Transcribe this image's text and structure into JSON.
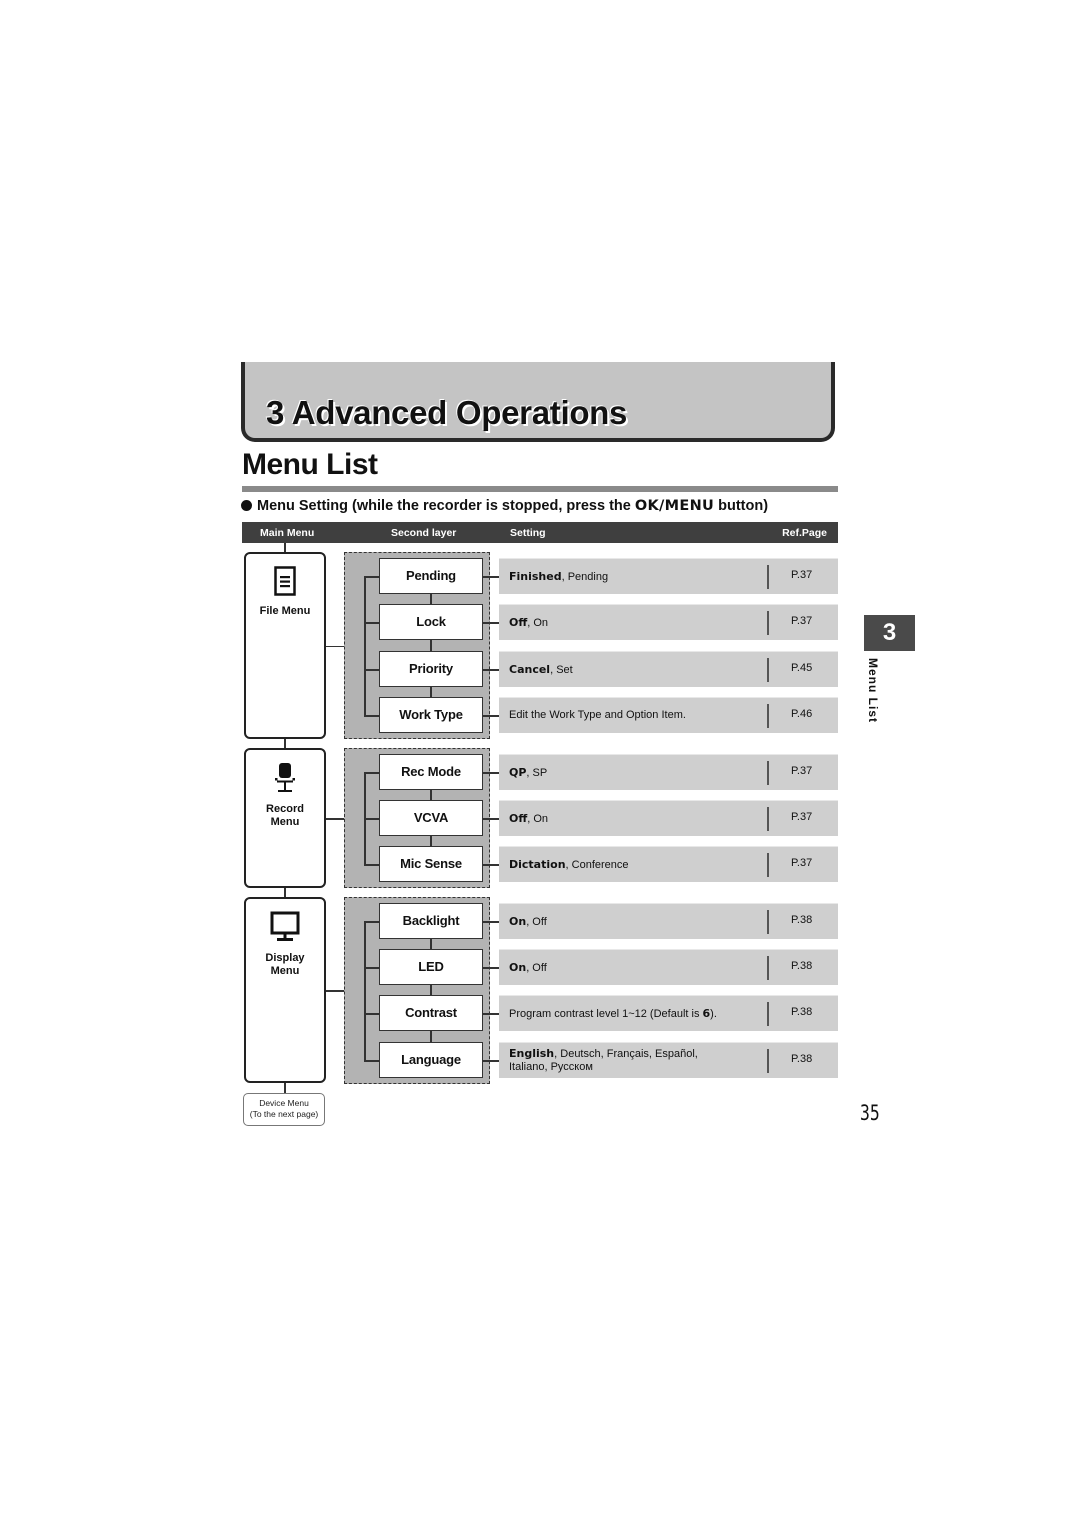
{
  "chapter": {
    "number": "3",
    "title": "3  Advanced Operations"
  },
  "page_title": "Menu List",
  "subheading": {
    "prefix": "Menu Setting (while the recorder is stopped, press the ",
    "button_name": "OK/MENU",
    "suffix": " button)"
  },
  "table_header": {
    "main_menu": "Main Menu",
    "second_layer": "Second layer",
    "setting": "Setting",
    "ref_page": "Ref.Page"
  },
  "menus": [
    {
      "icon": "file-document-icon",
      "label_lines": [
        "File Menu"
      ],
      "items": [
        {
          "name": "Pending",
          "setting_bold": "Finished",
          "setting_rest": ", Pending",
          "setting_line2": "",
          "ref": "P.37"
        },
        {
          "name": "Lock",
          "setting_bold": "Off",
          "setting_rest": ", On",
          "setting_line2": "",
          "ref": "P.37"
        },
        {
          "name": "Priority",
          "setting_bold": "Cancel",
          "setting_rest": ", Set",
          "setting_line2": "",
          "ref": "P.45"
        },
        {
          "name": "Work Type",
          "setting_bold": "",
          "setting_rest": "Edit the Work Type and Option Item.",
          "setting_line2": "",
          "ref": "P.46"
        }
      ]
    },
    {
      "icon": "microphone-stand-icon",
      "label_lines": [
        "Record",
        "Menu"
      ],
      "items": [
        {
          "name": "Rec Mode",
          "setting_bold": "QP",
          "setting_rest": ", SP",
          "setting_line2": "",
          "ref": "P.37"
        },
        {
          "name": "VCVA",
          "setting_bold": "Off",
          "setting_rest": ", On",
          "setting_line2": "",
          "ref": "P.37"
        },
        {
          "name": "Mic Sense",
          "setting_bold": "Dictation",
          "setting_rest": ", Conference",
          "setting_line2": "",
          "ref": "P.37"
        }
      ]
    },
    {
      "icon": "monitor-display-icon",
      "label_lines": [
        "Display",
        "Menu"
      ],
      "items": [
        {
          "name": "Backlight",
          "setting_bold": "On",
          "setting_rest": ", Off",
          "setting_line2": "",
          "ref": "P.38"
        },
        {
          "name": "LED",
          "setting_bold": "On",
          "setting_rest": ", Off",
          "setting_line2": "",
          "ref": "P.38"
        },
        {
          "name": "Contrast",
          "setting_bold": "",
          "setting_rest": "Program contrast level 1~12 (Default is ",
          "setting_bold_after": "6",
          "setting_after": ").",
          "setting_line2": "",
          "ref": "P.38"
        },
        {
          "name": "Language",
          "setting_bold": "English",
          "setting_rest": ", Deutsch, Français, Español,",
          "setting_line2": "Italiano, Русском",
          "ref": "P.38"
        }
      ]
    }
  ],
  "device_menu": {
    "line1": "Device Menu",
    "line2": "(To the next page)"
  },
  "side_tab": {
    "number": "3",
    "label": "Menu List"
  },
  "page_number": "35"
}
